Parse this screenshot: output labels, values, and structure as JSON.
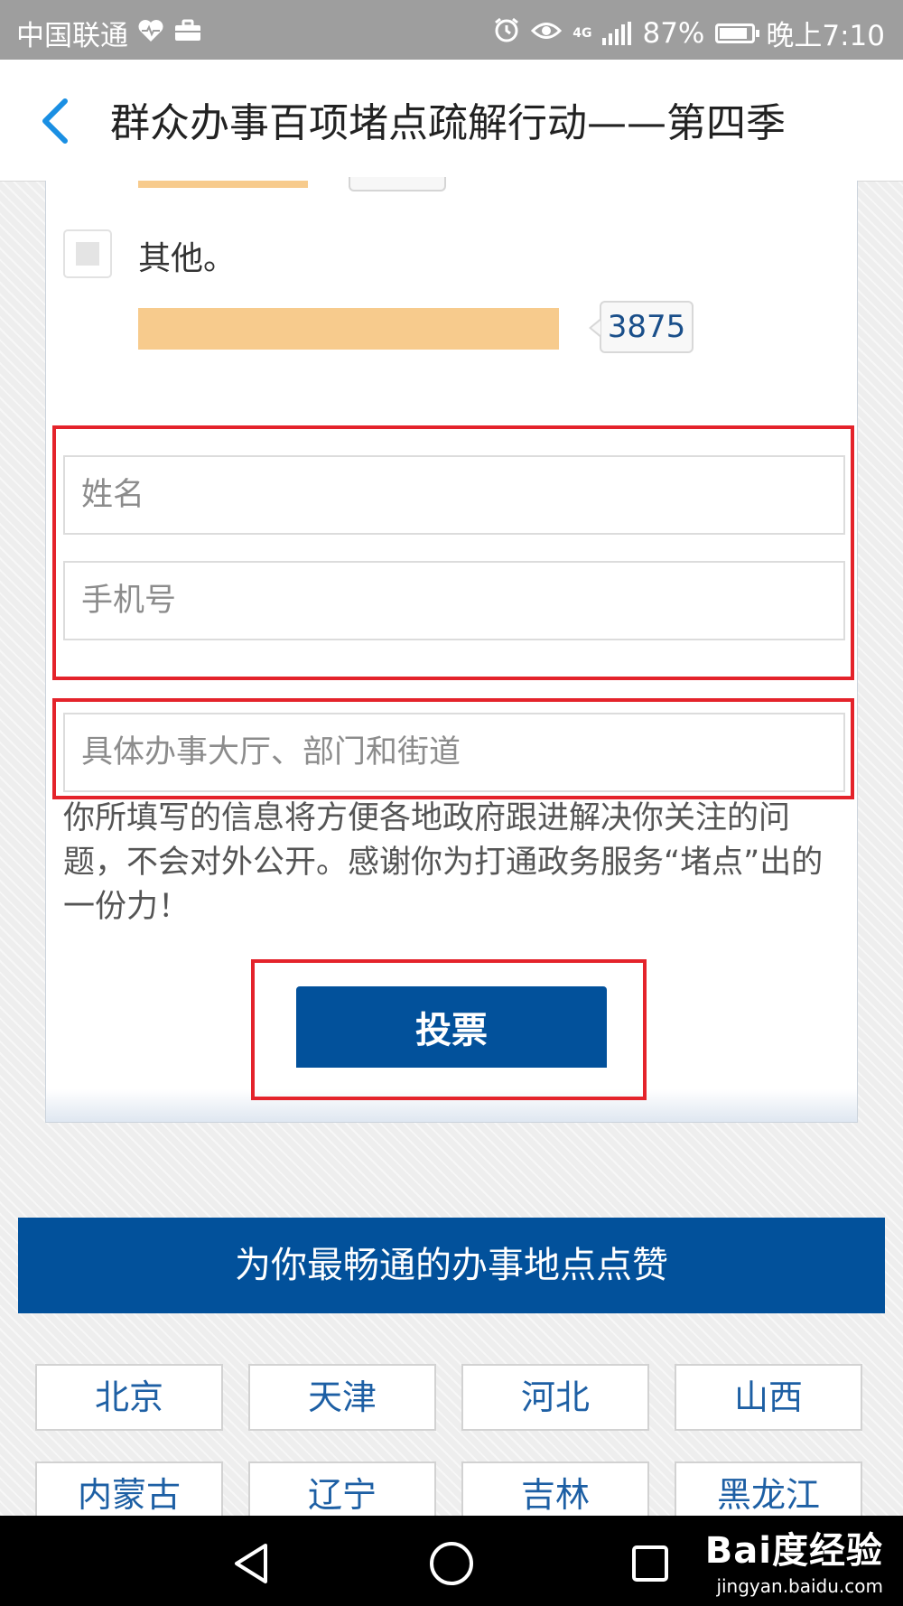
{
  "status_bar": {
    "carrier": "中国联通",
    "network": "4G",
    "battery": "87%",
    "battery_level": 0.87,
    "time": "晚上7:10"
  },
  "header": {
    "title": "群众办事百项堵点疏解行动——第四季"
  },
  "poll": {
    "option_label": "其他。",
    "option_votes": "3875"
  },
  "form": {
    "name_placeholder": "姓名",
    "phone_placeholder": "手机号",
    "location_placeholder": "具体办事大厅、部门和街道",
    "notice": "你所填写的信息将方便各地政府跟进解决你关注的问题，不会对外公开。感谢你为打通政务服务“堵点”出的一份力！",
    "vote_button": "投票"
  },
  "regions": {
    "title": "为你最畅通的办事地点点赞",
    "items": [
      "北京",
      "天津",
      "河北",
      "山西",
      "内蒙古",
      "辽宁",
      "吉林",
      "黑龙江"
    ]
  },
  "watermark": {
    "logo": "Bai度经验",
    "url": "jingyan.baidu.com"
  },
  "colors": {
    "primary": "#02519b",
    "highlight_red": "#e4232b",
    "bar_orange": "#f7cb8d",
    "back_arrow": "#1a8fe3"
  }
}
